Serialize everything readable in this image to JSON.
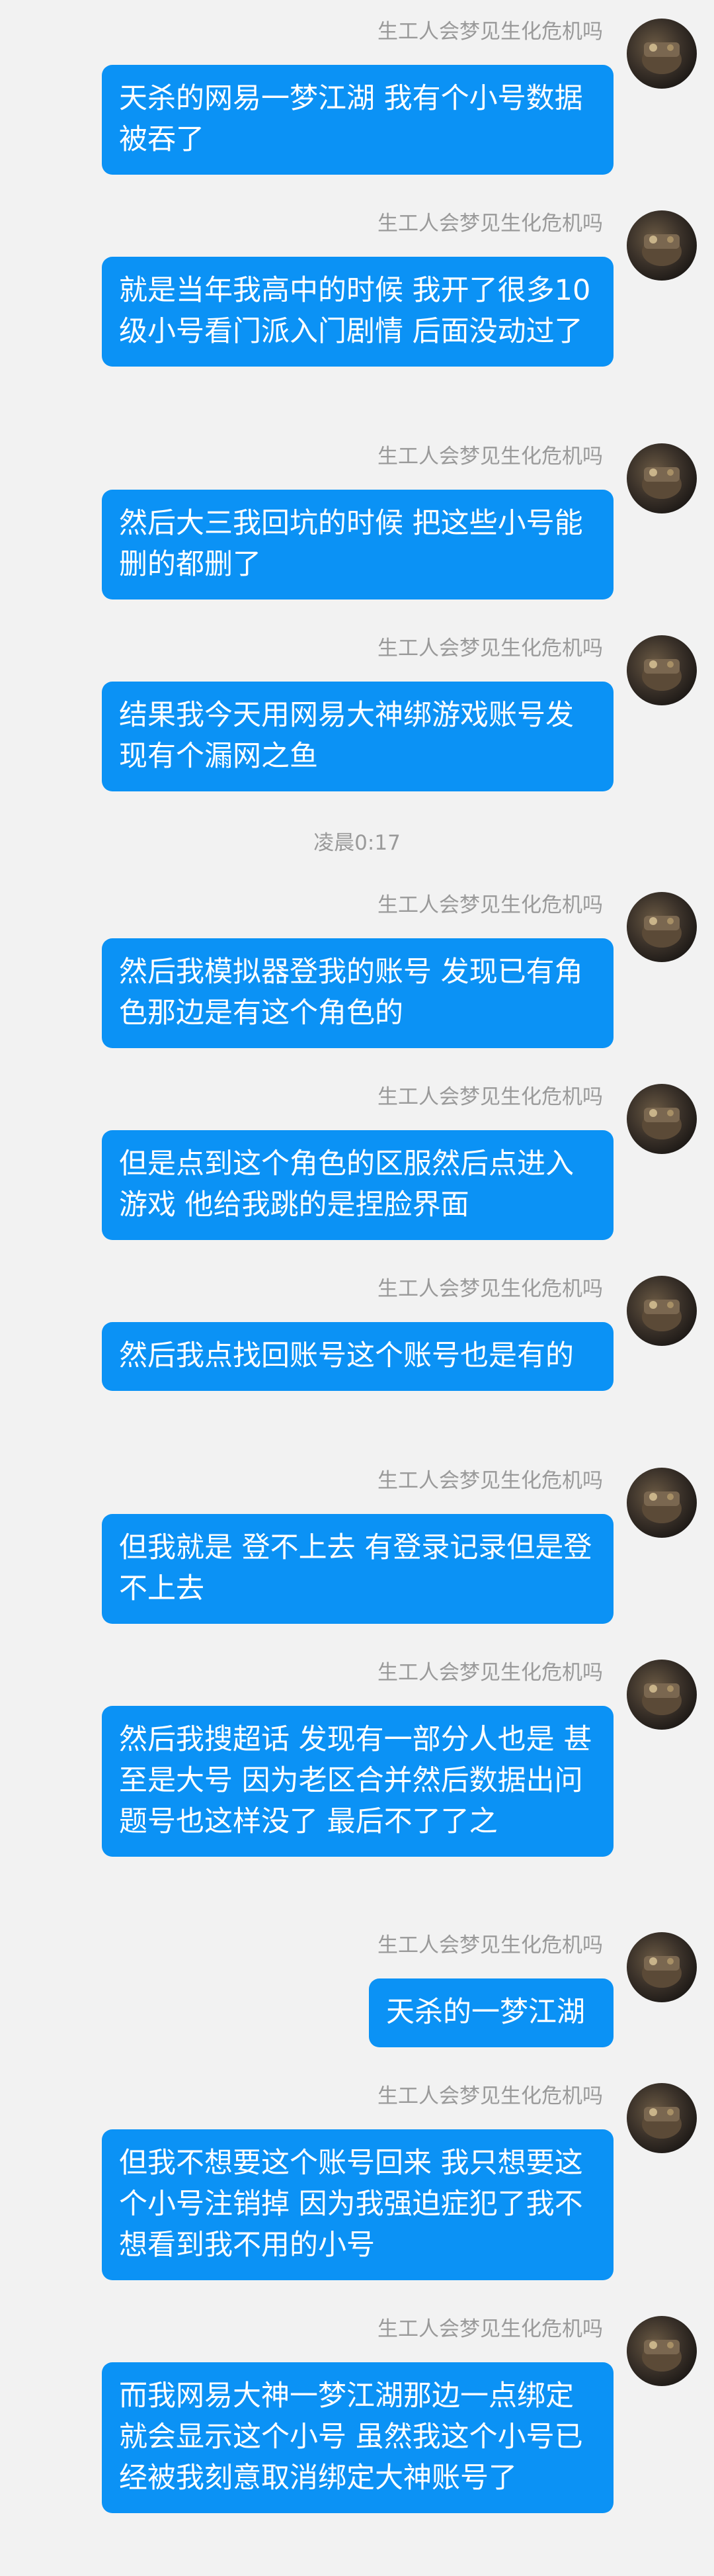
{
  "sender_name": "生工人会梦见生化危机吗",
  "timestamp": "凌晨0:17",
  "colors": {
    "bubble": "#0b92f5",
    "background": "#f2f2f2",
    "meta_text": "#9a9a9a"
  },
  "messages": [
    {
      "text": "天杀的网易一梦江湖 我有个小号数据被吞了"
    },
    {
      "text": "就是当年我高中的时候 我开了很多10级小号看门派入门剧情 后面没动过了"
    },
    {
      "text": "然后大三我回坑的时候 把这些小号能删的都删了"
    },
    {
      "text": "结果我今天用网易大神绑游戏账号发现有个漏网之鱼"
    },
    {
      "text": "然后我模拟器登我的账号 发现已有角色那边是有这个角色的"
    },
    {
      "text": "但是点到这个角色的区服然后点进入游戏 他给我跳的是捏脸界面"
    },
    {
      "text": "然后我点找回账号这个账号也是有的"
    },
    {
      "text": "但我就是 登不上去 有登录记录但是登不上去"
    },
    {
      "text": "然后我搜超话 发现有一部分人也是 甚至是大号 因为老区合并然后数据出问题号也这样没了 最后不了了之"
    },
    {
      "text": "天杀的一梦江湖"
    },
    {
      "text": "但我不想要这个账号回来 我只想要这个小号注销掉 因为我强迫症犯了我不想看到我不用的小号"
    },
    {
      "text": "而我网易大神一梦江湖那边一点绑定就会显示这个小号 虽然我这个小号已经被我刻意取消绑定大神账号了"
    }
  ]
}
